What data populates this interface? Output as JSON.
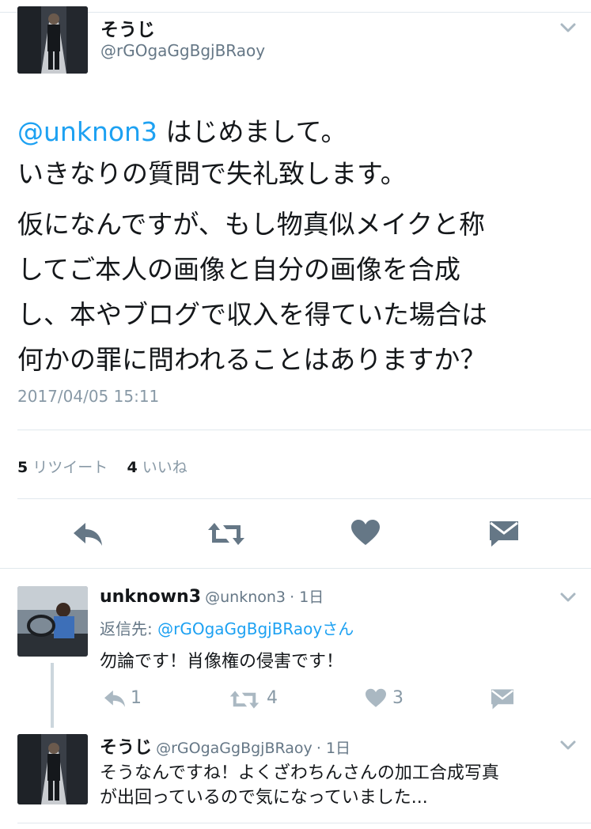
{
  "main_tweet": {
    "display_name": "そうじ",
    "handle": "@rGOgaGgBgjBRaoy",
    "mention": "@unknon3",
    "line1_rest": " はじめまして。",
    "line2": "いきなりの質問で失礼致します。",
    "body_lines": [
      "仮になんですが、もし物真似メイクと称",
      "してご本人の画像と自分の画像を合成",
      "し、本やブログで収入を得ていた場合は",
      "何かの罪に問われることはありますか？"
    ],
    "timestamp": "2017/04/05 15:11",
    "retweet_count": "5",
    "retweet_label": "リツイート",
    "like_count": "4",
    "like_label": "いいね"
  },
  "actions": {
    "icons": [
      "reply-icon",
      "retweet-icon",
      "like-icon",
      "direct-message-icon"
    ]
  },
  "replies": [
    {
      "display_name": "unknown3",
      "handle": "@unknon3",
      "time": "· 1日",
      "reply_to_prefix": "返信先: ",
      "reply_to_handle": "@rGOgaGgBgjBRaoy",
      "reply_to_suffix": "さん",
      "text": "勿論です！肖像権の侵害です！",
      "reply_count": "1",
      "retweet_count": "4",
      "like_count": "3"
    },
    {
      "display_name": "そうじ",
      "handle": "@rGOgaGgBgjBRaoy",
      "time": "· 1日",
      "text_line1": "そうなんですね！よくざわちんさんの加工合成写真",
      "text_line2": "が出回っているので気になっていました..."
    }
  ],
  "colors": {
    "link": "#1da1f2",
    "action_icon": "#657786",
    "reply_icon": "#aab8c2",
    "divider": "#e1e8ed"
  }
}
